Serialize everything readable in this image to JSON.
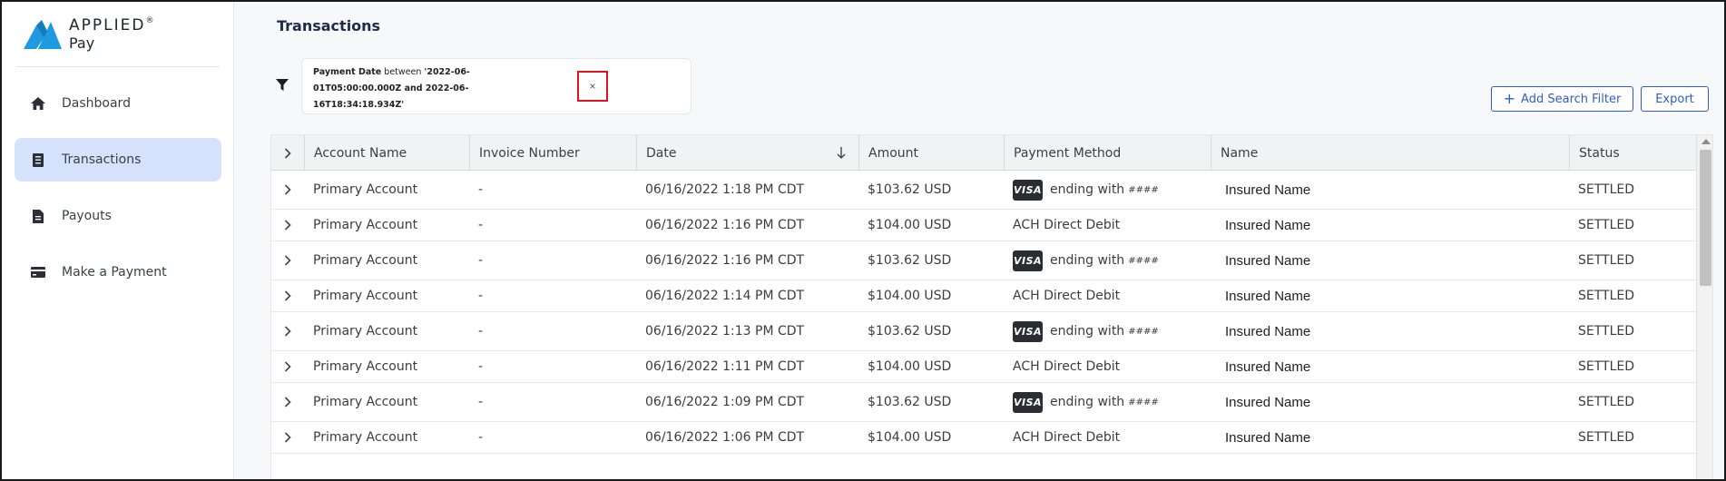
{
  "brand": {
    "word1": "APPLIED",
    "tm": "®",
    "word2": "Pay",
    "accent": "#1e9ae0"
  },
  "sidebar": {
    "items": [
      {
        "label": "Dashboard",
        "icon": "home-icon",
        "active": false
      },
      {
        "label": "Transactions",
        "icon": "receipt-icon",
        "active": true
      },
      {
        "label": "Payouts",
        "icon": "document-icon",
        "active": false
      },
      {
        "label": "Make a Payment",
        "icon": "credit-card-icon",
        "active": false
      }
    ]
  },
  "header": {
    "title": "Transactions"
  },
  "filter": {
    "field": "Payment Date",
    "operator": "between",
    "line1_rest": "'2022-06-",
    "line2": "01T05:00:00.000Z and 2022-06-",
    "line3": "16T18:34:18.934Z'",
    "close": "×"
  },
  "actions": {
    "add_filter": "Add Search Filter",
    "add_plus": "+",
    "export": "Export"
  },
  "table": {
    "columns": [
      "Account Name",
      "Invoice Number",
      "Date",
      "Amount",
      "Payment Method",
      "Name",
      "Status"
    ],
    "rows": [
      {
        "account": "Primary Account",
        "invoice": "-",
        "date": "06/16/2022 1:18 PM CDT",
        "amount": "$103.62 USD",
        "method": "visa",
        "method_text": "ending with",
        "last4": "####",
        "name": "Insured Name",
        "status": "SETTLED"
      },
      {
        "account": "Primary Account",
        "invoice": "-",
        "date": "06/16/2022 1:16 PM CDT",
        "amount": "$104.00 USD",
        "method": "ach",
        "method_text": "ACH Direct Debit",
        "last4": "",
        "name": "Insured Name",
        "status": "SETTLED"
      },
      {
        "account": "Primary Account",
        "invoice": "-",
        "date": "06/16/2022 1:16 PM CDT",
        "amount": "$103.62 USD",
        "method": "visa",
        "method_text": "ending with",
        "last4": "####",
        "name": "Insured Name",
        "status": "SETTLED"
      },
      {
        "account": "Primary Account",
        "invoice": "-",
        "date": "06/16/2022 1:14 PM CDT",
        "amount": "$104.00 USD",
        "method": "ach",
        "method_text": "ACH Direct Debit",
        "last4": "",
        "name": "Insured Name",
        "status": "SETTLED"
      },
      {
        "account": "Primary Account",
        "invoice": "-",
        "date": "06/16/2022 1:13 PM CDT",
        "amount": "$103.62 USD",
        "method": "visa",
        "method_text": "ending with",
        "last4": "####",
        "name": "Insured Name",
        "status": "SETTLED"
      },
      {
        "account": "Primary Account",
        "invoice": "-",
        "date": "06/16/2022 1:11 PM CDT",
        "amount": "$104.00 USD",
        "method": "ach",
        "method_text": "ACH Direct Debit",
        "last4": "",
        "name": "Insured Name",
        "status": "SETTLED"
      },
      {
        "account": "Primary Account",
        "invoice": "-",
        "date": "06/16/2022 1:09 PM CDT",
        "amount": "$103.62 USD",
        "method": "visa",
        "method_text": "ending with",
        "last4": "####",
        "name": "Insured Name",
        "status": "SETTLED"
      },
      {
        "account": "Primary Account",
        "invoice": "-",
        "date": "06/16/2022 1:06 PM CDT",
        "amount": "$104.00 USD",
        "method": "ach",
        "method_text": "ACH Direct Debit",
        "last4": "",
        "name": "Insured Name",
        "status": "SETTLED"
      }
    ],
    "visa_label": "VISA",
    "sorted_column": "Date",
    "sort_direction": "descending"
  }
}
